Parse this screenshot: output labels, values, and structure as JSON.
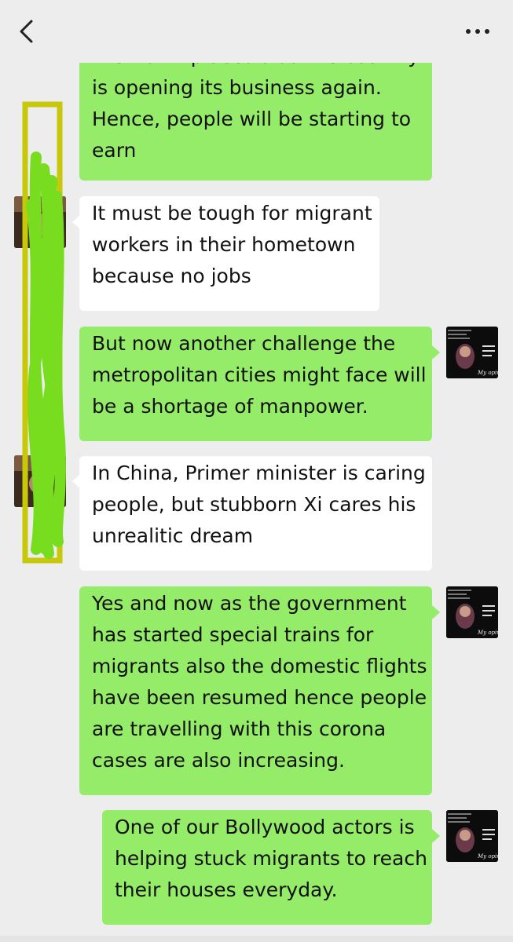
{
  "header": {
    "back_icon": "chevron-left-icon",
    "title": "",
    "more_icon": "more-horizontal-icon"
  },
  "colors": {
    "background": "#ededed",
    "sent_bubble": "#95ec69",
    "received_bubble": "#ffffff",
    "redaction_green": "#78dd1e",
    "redaction_box": "#c8c80a"
  },
  "messages": [
    {
      "from": "me",
      "lines": [
        "their own places also the country",
        "is opening its business again.",
        "Hence, people will be starting to",
        "earn"
      ]
    },
    {
      "from": "other",
      "lines": [
        "It must be tough for migrant",
        "workers in their hometown",
        "because no jobs"
      ]
    },
    {
      "from": "me",
      "lines": [
        "But now another challenge the",
        "metropolitan cities might face will",
        "be a shortage of manpower."
      ]
    },
    {
      "from": "other",
      "lines": [
        "In China, Primer minister is caring",
        "people, but stubborn Xi cares his",
        "unrealitic dream"
      ]
    },
    {
      "from": "me",
      "lines": [
        "Yes and now as the government",
        "has started special trains for",
        "migrants also the domestic flights",
        "have been resumed hence people",
        "are travelling with this corona",
        "cases are also increasing."
      ]
    },
    {
      "from": "me",
      "lines": [
        "One of our Bollywood actors is",
        "helping stuck migrants to reach",
        "their houses everyday."
      ]
    }
  ],
  "avatar": {
    "icon": "profile-photo-avatar",
    "tagline": "My opinion"
  }
}
